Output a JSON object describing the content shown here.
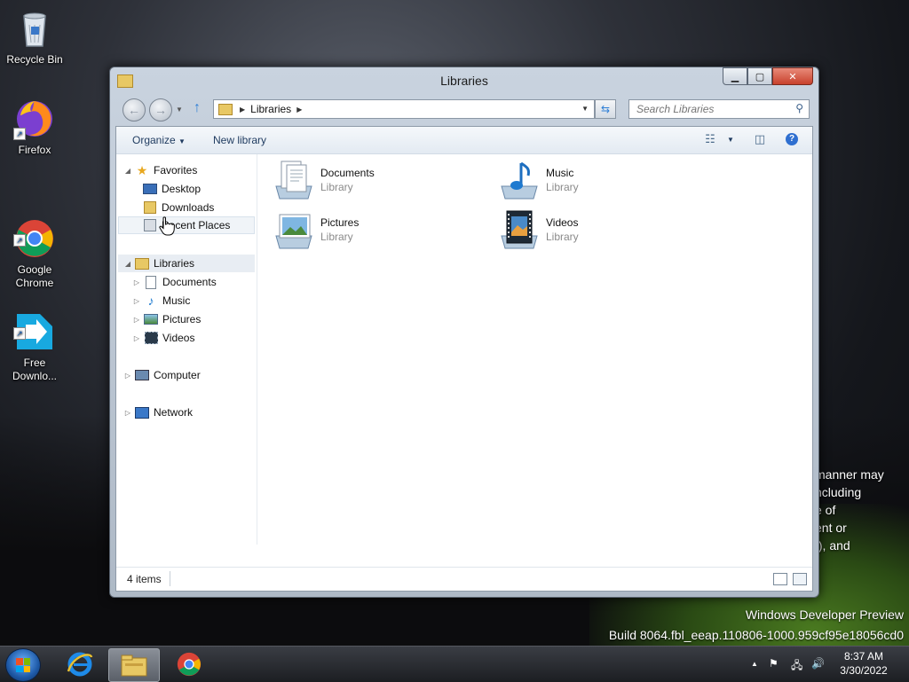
{
  "desktop": {
    "icons": [
      {
        "label": "Recycle Bin"
      },
      {
        "label": "Firefox"
      },
      {
        "label": "Google\nChrome"
      },
      {
        "label": "Free\nDownlo..."
      }
    ],
    "legal_lines": [
      "manner may",
      "ncluding",
      "e of",
      "ent or",
      "f), and"
    ],
    "watermark": {
      "line1": "Windows Developer Preview",
      "line2": "Build 8064.fbl_eeap.110806-1000.959cf95e18056cd0"
    }
  },
  "window": {
    "title": "Libraries",
    "address": {
      "crumb": "Libraries"
    },
    "search": {
      "placeholder": "Search Libraries"
    },
    "toolbar": {
      "organize": "Organize",
      "new_library": "New library"
    },
    "nav": {
      "favorites": "Favorites",
      "desktop": "Desktop",
      "downloads": "Downloads",
      "recent_places": "Recent Places",
      "libraries": "Libraries",
      "documents": "Documents",
      "music": "Music",
      "pictures": "Pictures",
      "videos": "Videos",
      "computer": "Computer",
      "network": "Network"
    },
    "libraries": [
      {
        "name": "Documents",
        "type": "Library"
      },
      {
        "name": "Music",
        "type": "Library"
      },
      {
        "name": "Pictures",
        "type": "Library"
      },
      {
        "name": "Videos",
        "type": "Library"
      }
    ],
    "status": {
      "items": "4 items"
    }
  },
  "taskbar": {
    "clock": {
      "time": "8:37 AM",
      "date": "3/30/2022"
    }
  }
}
